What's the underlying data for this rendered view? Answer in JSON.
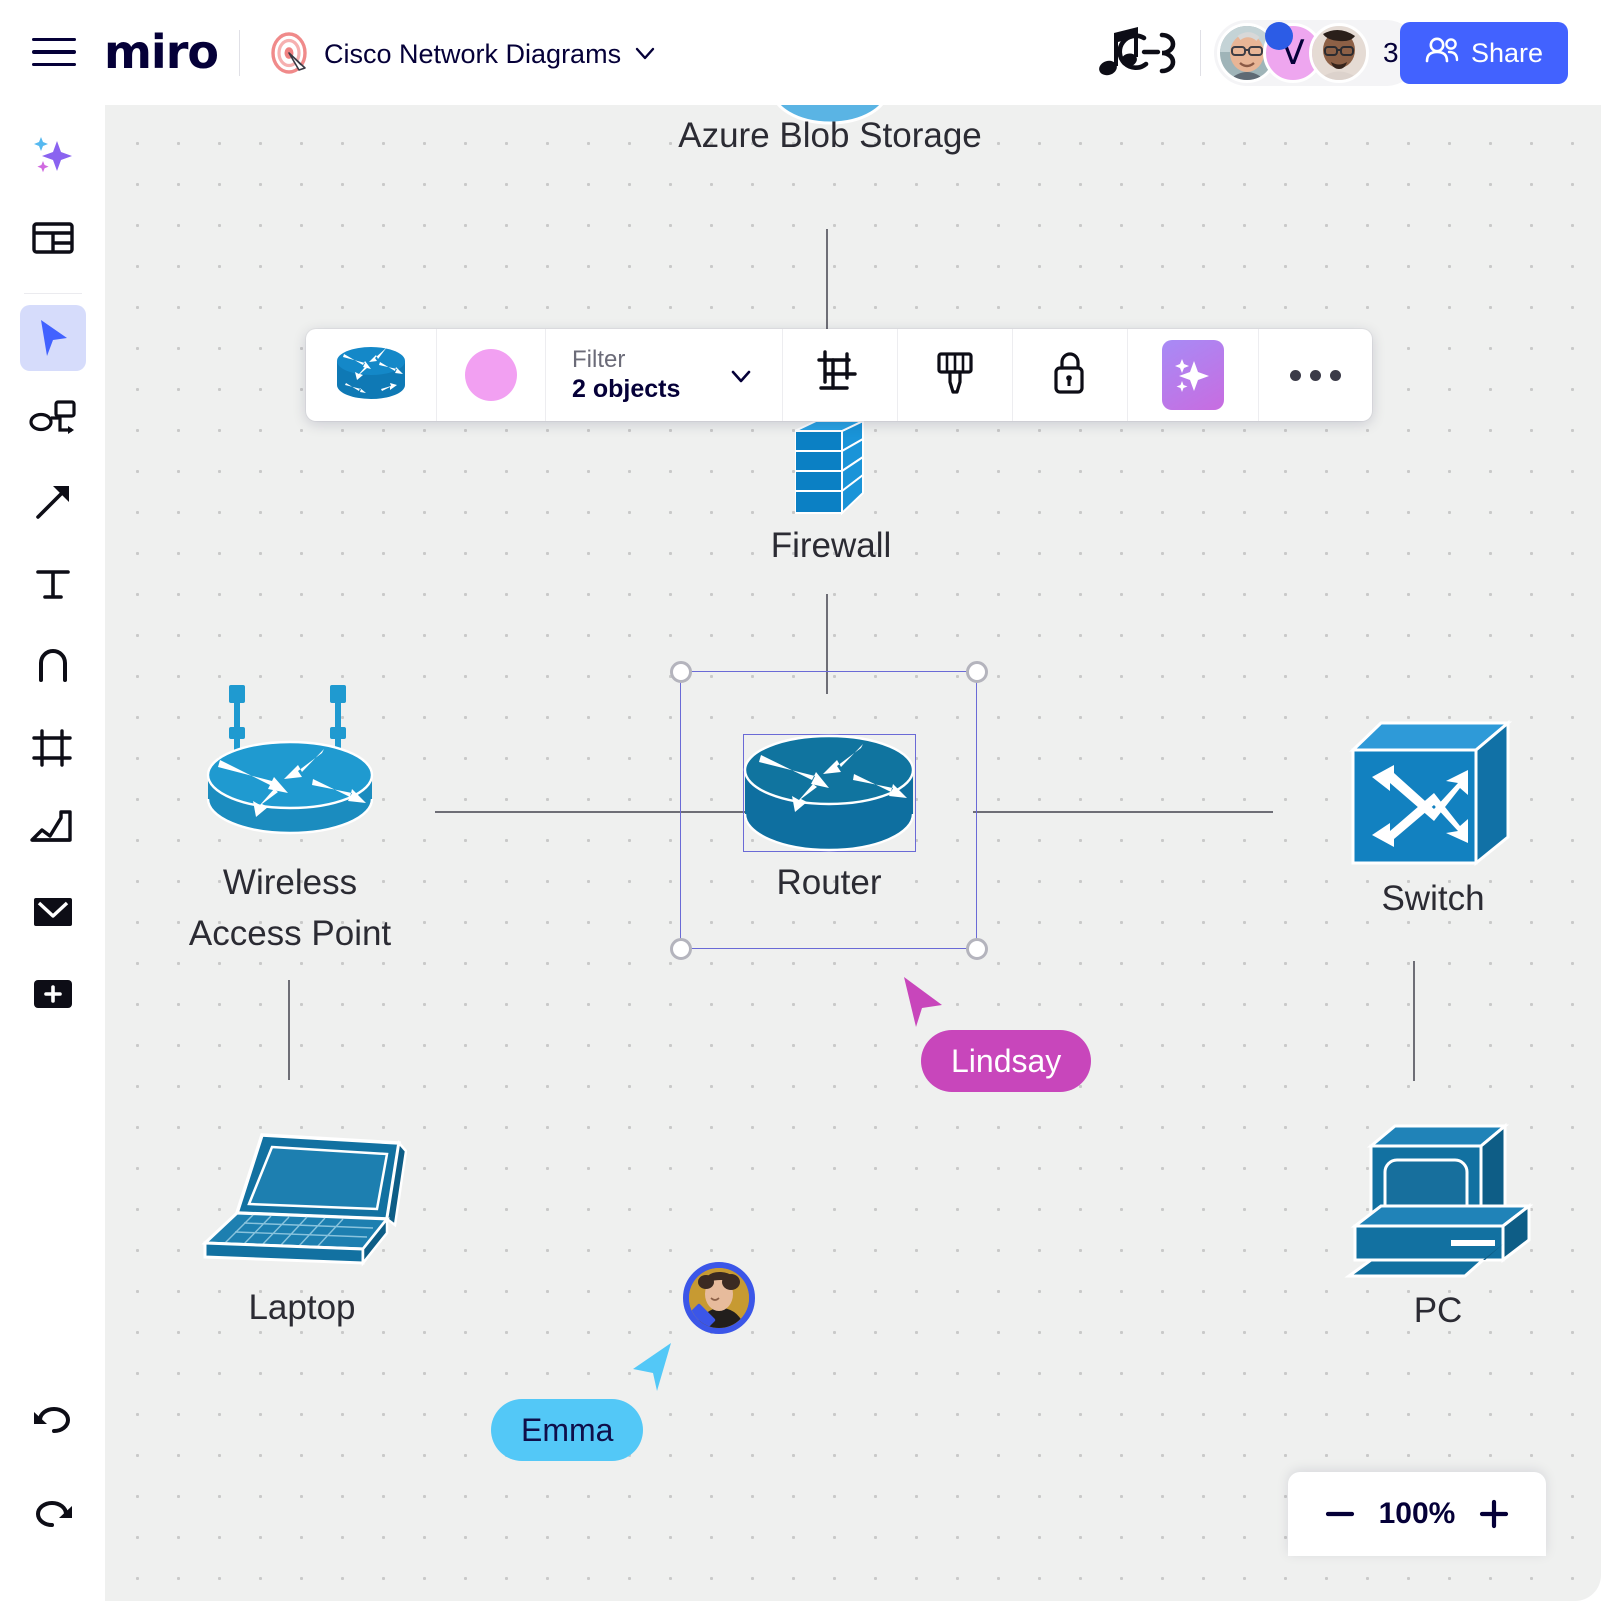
{
  "header": {
    "menu_icon": "hamburger-menu-icon",
    "logo_text": "miro",
    "board_icon": "target-board-icon",
    "board_title": "Cisco Network Diagrams",
    "board_caret_icon": "chevron-down-icon",
    "music_icon": "music-notes-icon",
    "avatar_initial": "V",
    "collaborator_count": "3",
    "share_label": "Share",
    "share_icon": "people-icon",
    "share_color": "#4262ff"
  },
  "rail": {
    "items": [
      {
        "name": "ai-sparkle-tool",
        "icon": "sparkles-icon",
        "active": false
      },
      {
        "name": "templates-tool",
        "icon": "layout-template-icon",
        "active": false
      },
      {
        "name": "select-tool",
        "icon": "cursor-arrow-icon",
        "active": true
      },
      {
        "name": "diagram-tool",
        "icon": "shapes-connector-icon",
        "active": false
      },
      {
        "name": "arrow-tool",
        "icon": "arrow-icon",
        "active": false
      },
      {
        "name": "text-tool",
        "icon": "text-t-icon",
        "active": false
      },
      {
        "name": "pen-tool",
        "icon": "pen-a-icon",
        "active": false
      },
      {
        "name": "frame-tool",
        "icon": "frame-icon",
        "active": false
      },
      {
        "name": "chart-tool",
        "icon": "chart-icon",
        "active": false
      },
      {
        "name": "comment-tool",
        "icon": "envelope-icon",
        "active": false
      },
      {
        "name": "more-apps-tool",
        "icon": "plus-box-icon",
        "active": false
      }
    ],
    "undo_icon": "undo-arrow-icon",
    "redo_icon": "redo-arrow-icon"
  },
  "context_toolbar": {
    "shape_icon": "cisco-router-icon",
    "color_swatch": "#f2a0f2",
    "color_name": "color-swatch",
    "filter_label": "Filter",
    "filter_value": "2 objects",
    "filter_caret_icon": "chevron-down-icon",
    "frame_icon": "crop-frame-icon",
    "paint_icon": "paintbrush-icon",
    "lock_icon": "unlock-icon",
    "ai_icon": "ai-sparkle-icon",
    "more_icon": "ellipsis-icon"
  },
  "canvas": {
    "nodes": [
      {
        "id": "azure",
        "label": "Azure Blob Storage",
        "icon": "azure-blob-storage-icon"
      },
      {
        "id": "firewall",
        "label": "Firewall",
        "icon": "firewall-brick-icon"
      },
      {
        "id": "router",
        "label": "Router",
        "icon": "cisco-router-icon",
        "selected": true
      },
      {
        "id": "wap",
        "label": "Wireless\nAccess Point",
        "icon": "wireless-access-point-icon"
      },
      {
        "id": "switch",
        "label": "Switch",
        "icon": "network-switch-icon"
      },
      {
        "id": "laptop",
        "label": "Laptop",
        "icon": "laptop-icon"
      },
      {
        "id": "pc",
        "label": "PC",
        "icon": "desktop-pc-icon"
      }
    ],
    "cursors": [
      {
        "name": "Lindsay",
        "color": "#c846bb",
        "text_color": "#ffffff"
      },
      {
        "name": "Emma",
        "color": "#53c8f7",
        "text_color": "#0f0f4a"
      }
    ]
  },
  "zoom_control": {
    "minus_icon": "minus-icon",
    "value": "100%",
    "plus_icon": "plus-icon"
  }
}
